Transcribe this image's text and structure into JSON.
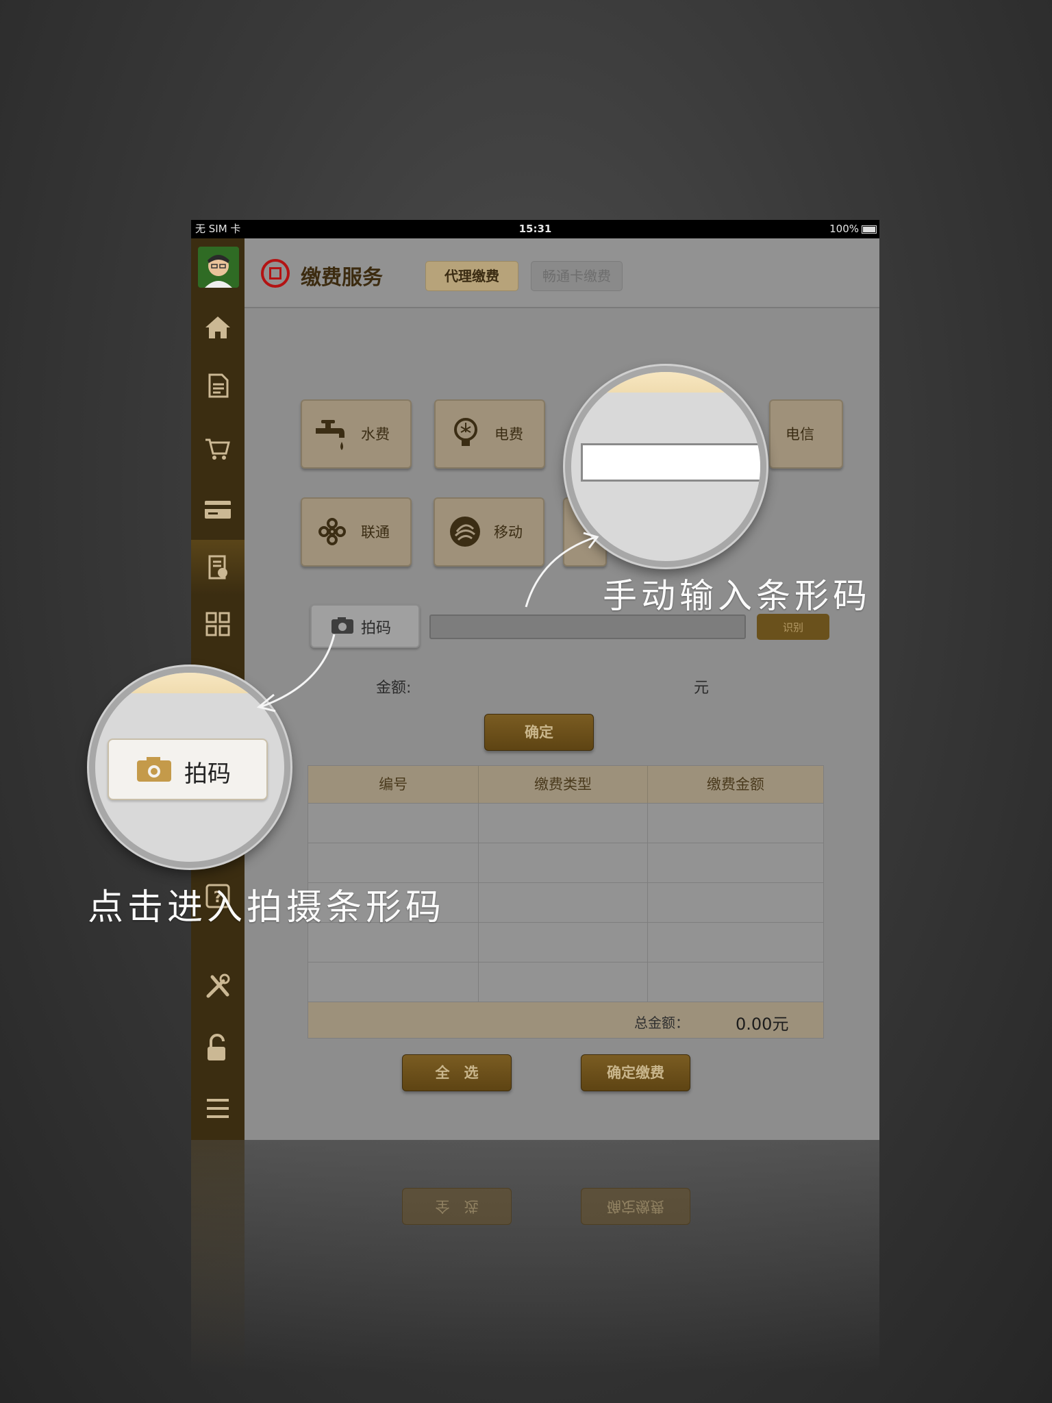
{
  "status_bar": {
    "carrier": "无 SIM 卡",
    "time": "15:31",
    "battery": "100%"
  },
  "header": {
    "title": "缴费服务",
    "tabs": [
      "代理缴费",
      "畅通卡缴费"
    ]
  },
  "sidebar": {
    "items": [
      "home-icon",
      "document-icon",
      "cart-icon",
      "card-icon",
      "bill-icon",
      "grid-icon",
      "help-icon",
      "tools-icon",
      "lock-icon",
      "menu-icon"
    ]
  },
  "services": [
    {
      "label": "水费",
      "icon": "faucet-icon"
    },
    {
      "label": "电费",
      "icon": "bulb-icon"
    },
    {
      "label": "电信",
      "icon": "telecom-icon"
    },
    {
      "label": "联通",
      "icon": "unicom-icon"
    },
    {
      "label": "移动",
      "icon": "mobile-icon"
    }
  ],
  "scan_button": "拍码",
  "recognize_button": "识别",
  "amount": {
    "label": "金额:",
    "unit": "元"
  },
  "confirm_button": "确定",
  "table": {
    "columns": [
      "编号",
      "缴费类型",
      "缴费金额"
    ],
    "total_label": "总金额：",
    "total_value": "0.00元"
  },
  "select_all_button": "全　选",
  "pay_button": "确定缴费",
  "callouts": {
    "manual": "手动输入条形码",
    "scan": "点击进入拍摄条形码"
  },
  "colors": {
    "sidebar": "#3b2d11",
    "accent": "#7a5c22",
    "logo": "#b31313"
  }
}
